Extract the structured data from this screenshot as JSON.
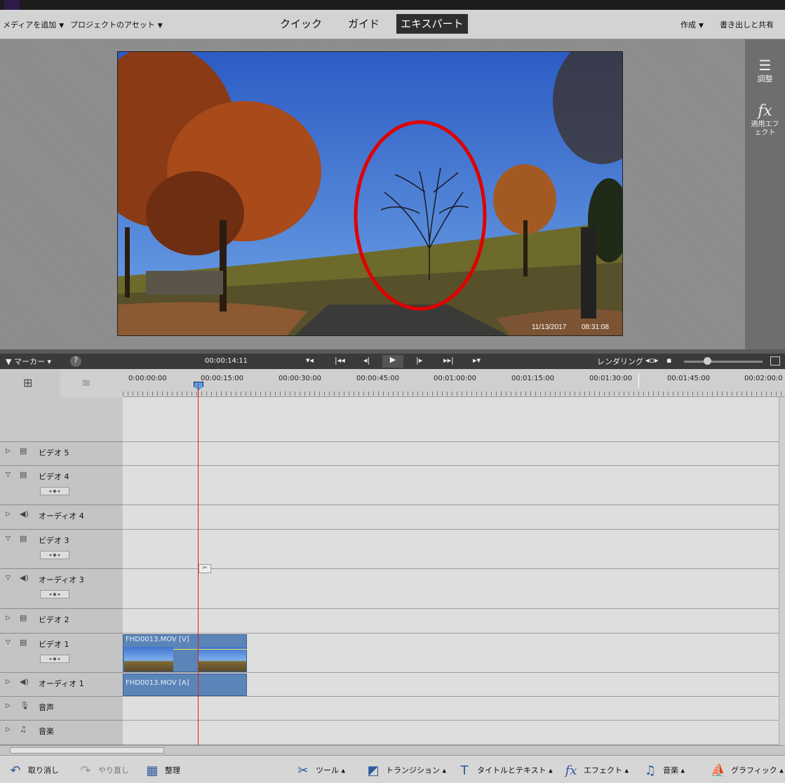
{
  "menubar": {
    "add_media": "メディアを追加",
    "project_assets": "プロジェクトのアセット",
    "tabs": [
      "クイック",
      "ガイド",
      "エキスパート"
    ],
    "active_tab": "エキスパート",
    "create": "作成",
    "export_share": "書き出しと共有"
  },
  "preview": {
    "timestamp_date": "11/13/2017",
    "timestamp_time": "08:31:08"
  },
  "right_panel": {
    "adjust": "調整",
    "applied_effects": "適用エフェクト"
  },
  "transport": {
    "marker": "マーカー",
    "timecode": "00:00:14:11",
    "render": "レンダリング"
  },
  "ruler": {
    "ticks": [
      "0:00:00:00",
      "00:00:15:00",
      "00:00:30:00",
      "00:00:45:00",
      "00:01:00:00",
      "00:01:15:00",
      "00:01:30:00",
      "00:01:45:00",
      "00:02:00:0"
    ]
  },
  "tracks": [
    {
      "name": "ビデオ 5",
      "type": "video",
      "expanded": false
    },
    {
      "name": "ビデオ 4",
      "type": "video",
      "expanded": true
    },
    {
      "name": "オーディオ 4",
      "type": "audio",
      "expanded": false
    },
    {
      "name": "ビデオ 3",
      "type": "video",
      "expanded": true
    },
    {
      "name": "オーディオ 3",
      "type": "audio",
      "expanded": true
    },
    {
      "name": "ビデオ 2",
      "type": "video",
      "expanded": false
    },
    {
      "name": "ビデオ 1",
      "type": "video",
      "expanded": true
    },
    {
      "name": "オーディオ 1",
      "type": "audio",
      "expanded": false
    },
    {
      "name": "音声",
      "type": "voice",
      "expanded": false
    },
    {
      "name": "音楽",
      "type": "music",
      "expanded": false
    }
  ],
  "clips": {
    "video": "FHD0013.MOV [V]",
    "audio": "FHD0013.MOV [A]"
  },
  "bottombar": {
    "undo": "取り消し",
    "redo": "やり直し",
    "organize": "整理",
    "tools": "ツール",
    "transitions": "トランジション",
    "titles": "タイトルとテキスト",
    "effects": "エフェクト",
    "music": "音楽",
    "graphics": "グラフィック"
  },
  "colors": {
    "accent_active_tab": "#2e2e2e",
    "playhead": "#e02020",
    "clip": "#5b84b8",
    "highlight_ellipse": "#e00000"
  }
}
